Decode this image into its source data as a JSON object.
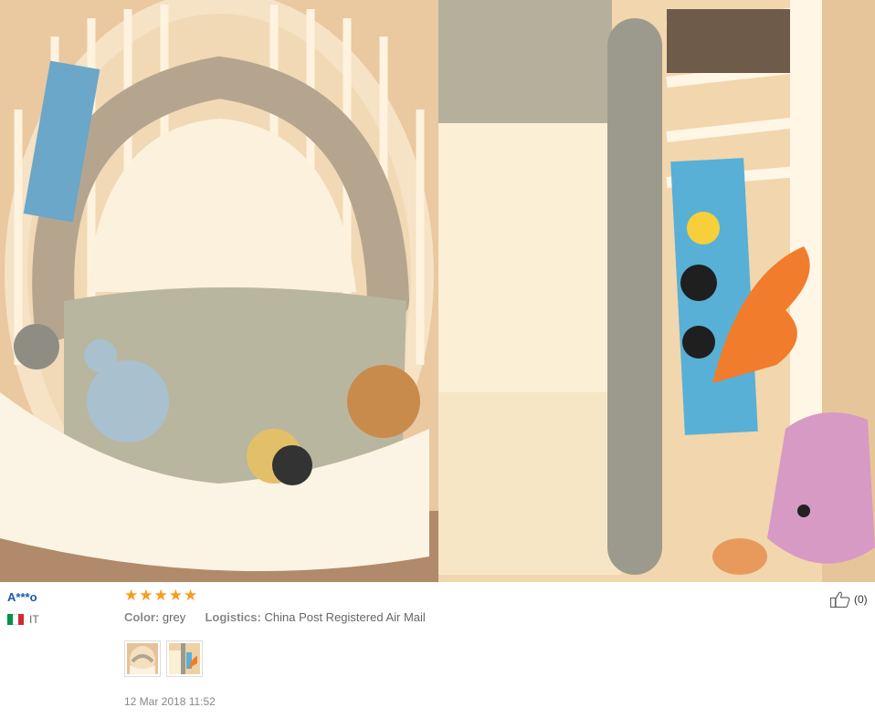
{
  "review": {
    "reviewer": "A***o",
    "country_code": "IT",
    "rating": 5,
    "stars": [
      "★",
      "★",
      "★",
      "★",
      "★"
    ],
    "color_label": "Color:",
    "color_value": "grey",
    "logistics_label": "Logistics:",
    "logistics_value": "China Post Registered Air Mail",
    "timestamp": "12 Mar 2018 11:52",
    "helpful_count": "(0)"
  },
  "colors": {
    "star": "#f59d1c",
    "name_link": "#1a5aa8",
    "flag_it": [
      "#009246",
      "#ffffff",
      "#ce2b37"
    ]
  },
  "icons": [
    "thumbs-up-icon",
    "italy-flag-icon",
    "star-icon"
  ]
}
